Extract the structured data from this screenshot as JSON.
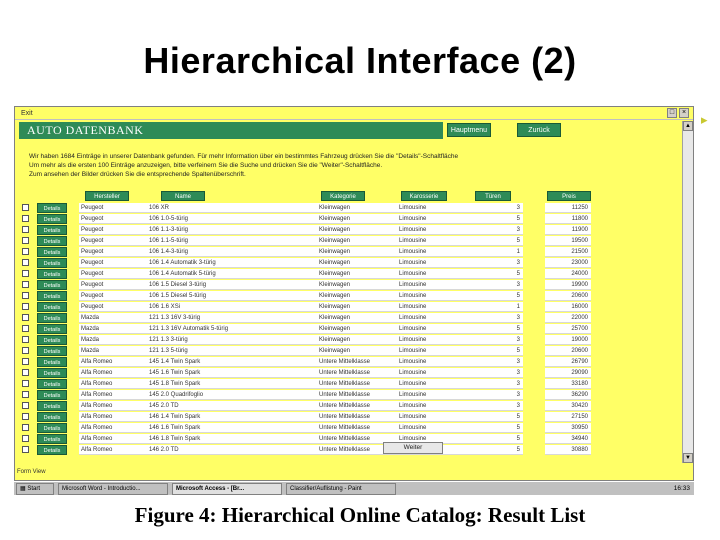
{
  "slide_title": "Hierarchical Interface (2)",
  "caption": "Figure 4: Hierarchical Online Catalog:  Result List",
  "window": {
    "title": "Exit",
    "header": "AUTO DATENBANK",
    "nav_buttons": [
      "Hauptmenu",
      "Zurück"
    ],
    "info_lines": [
      "Wir haben  1684 Einträge in unserer Datenbank gefunden.     Für mehr Information über ein bestimmtes Fahrzeug drücken Sie die \"Details\"-Schaltfläche",
      "Um mehr als die ersten 100 Einträge anzuzeigen, bitte verfeinern Sie die Suche und drücken Sie die \"Weiter\"-Schaltfläche.",
      "Zum ansehen der Bilder drücken Sie die entsprechende Spaltenüberschrift."
    ],
    "columns": [
      "Hersteller",
      "Name",
      "Kategorie",
      "Karosserie",
      "Türen",
      "Preis"
    ],
    "details_label": "Details",
    "rows": [
      {
        "maker": "Peugeot",
        "name": "106 XR",
        "category": "Kleinwagen",
        "body": "Limousine",
        "doors": "3",
        "price": "11250"
      },
      {
        "maker": "Peugeot",
        "name": "106 1.0-5-türig",
        "category": "Kleinwagen",
        "body": "Limousine",
        "doors": "5",
        "price": "11800"
      },
      {
        "maker": "Peugeot",
        "name": "106 1.1-3-türig",
        "category": "Kleinwagen",
        "body": "Limousine",
        "doors": "3",
        "price": "11900"
      },
      {
        "maker": "Peugeot",
        "name": "106 1.1-5-türig",
        "category": "Kleinwagen",
        "body": "Limousine",
        "doors": "5",
        "price": "19500"
      },
      {
        "maker": "Peugeot",
        "name": "106 1.4-3-türig",
        "category": "Kleinwagen",
        "body": "Limousine",
        "doors": "1",
        "price": "21500"
      },
      {
        "maker": "Peugeot",
        "name": "106 1.4 Automatik 3-türig",
        "category": "Kleinwagen",
        "body": "Limousine",
        "doors": "3",
        "price": "23000"
      },
      {
        "maker": "Peugeot",
        "name": "106 1.4 Automatik 5-türig",
        "category": "Kleinwagen",
        "body": "Limousine",
        "doors": "5",
        "price": "24000"
      },
      {
        "maker": "Peugeot",
        "name": "106 1.5 Diesel 3-türig",
        "category": "Kleinwagen",
        "body": "Limousine",
        "doors": "3",
        "price": "19900"
      },
      {
        "maker": "Peugeot",
        "name": "106 1.5 Diesel 5-türig",
        "category": "Kleinwagen",
        "body": "Limousine",
        "doors": "5",
        "price": "20600"
      },
      {
        "maker": "Peugeot",
        "name": "106 1.6 XSi",
        "category": "Kleinwagen",
        "body": "Limousine",
        "doors": "1",
        "price": "16000"
      },
      {
        "maker": "Mazda",
        "name": "121 1.3 16V 3-türig",
        "category": "Kleinwagen",
        "body": "Limousine",
        "doors": "3",
        "price": "22000"
      },
      {
        "maker": "Mazda",
        "name": "121 1.3 16V Automatik 5-türig",
        "category": "Kleinwagen",
        "body": "Limousine",
        "doors": "5",
        "price": "25700"
      },
      {
        "maker": "Mazda",
        "name": "121 1.3 3-türig",
        "category": "Kleinwagen",
        "body": "Limousine",
        "doors": "3",
        "price": "19000"
      },
      {
        "maker": "Mazda",
        "name": "121 1.3 5-türig",
        "category": "Kleinwagen",
        "body": "Limousine",
        "doors": "5",
        "price": "20600"
      },
      {
        "maker": "Alfa Romeo",
        "name": "145 1.4 Twin Spark",
        "category": "Untere Mittelklasse",
        "body": "Limousine",
        "doors": "3",
        "price": "26790"
      },
      {
        "maker": "Alfa Romeo",
        "name": "145 1.6 Twin Spark",
        "category": "Untere Mittelklasse",
        "body": "Limousine",
        "doors": "3",
        "price": "29090"
      },
      {
        "maker": "Alfa Romeo",
        "name": "145 1.8 Twin Spark",
        "category": "Untere Mittelklasse",
        "body": "Limousine",
        "doors": "3",
        "price": "33180"
      },
      {
        "maker": "Alfa Romeo",
        "name": "145 2.0 Quadrifoglio",
        "category": "Untere Mittelklasse",
        "body": "Limousine",
        "doors": "3",
        "price": "36290"
      },
      {
        "maker": "Alfa Romeo",
        "name": "145 2.0 TD",
        "category": "Untere Mittelklasse",
        "body": "Limousine",
        "doors": "3",
        "price": "30420"
      },
      {
        "maker": "Alfa Romeo",
        "name": "146 1.4 Twin Spark",
        "category": "Untere Mittelklasse",
        "body": "Limousine",
        "doors": "5",
        "price": "27150"
      },
      {
        "maker": "Alfa Romeo",
        "name": "146 1.6 Twin Spark",
        "category": "Untere Mittelklasse",
        "body": "Limousine",
        "doors": "5",
        "price": "30950"
      },
      {
        "maker": "Alfa Romeo",
        "name": "146 1.8 Twin Spark",
        "category": "Untere Mittelklasse",
        "body": "Limousine",
        "doors": "5",
        "price": "34940"
      },
      {
        "maker": "Alfa Romeo",
        "name": "146 2.0 TD",
        "category": "Untere Mittelklasse",
        "body": "Limousine",
        "doors": "5",
        "price": "30880"
      }
    ],
    "weiter_label": "Weiter",
    "status_text": "Form View"
  },
  "taskbar": {
    "start_label": "Start",
    "tasks": [
      "Microsoft Word - Introductio...",
      "Microsoft Access - [Br...",
      "Classifier/Auflistung - Paint"
    ],
    "clock": "16:33"
  }
}
